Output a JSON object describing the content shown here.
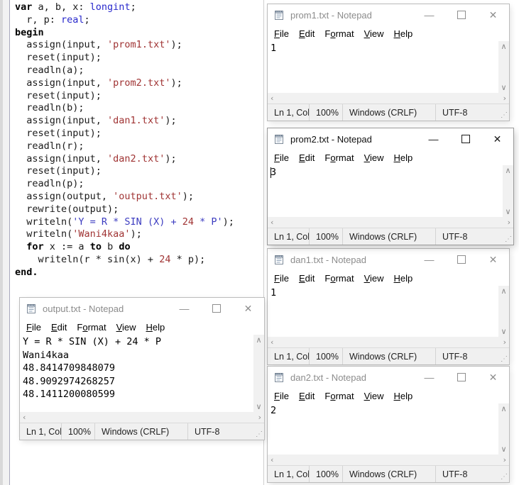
{
  "colors": {
    "keyword": "#000000",
    "type": "#2828cc",
    "string": "#a03434",
    "string_blue": "#3c3cc0",
    "number": "#a03434",
    "status_bg": "#f0f0f0",
    "inactive_title": "#8c8c8c",
    "active_title": "#111111"
  },
  "icons": {
    "minimize": "—",
    "close": "✕",
    "scroll_up": "∧",
    "scroll_down": "∨",
    "scroll_left": "‹",
    "scroll_right": "›",
    "resize_grip": "⋰",
    "app_icon": "notepad-icon"
  },
  "menu": {
    "items": [
      {
        "label": "File",
        "u": 0
      },
      {
        "label": "Edit",
        "u": 0
      },
      {
        "label": "Format",
        "u": 1
      },
      {
        "label": "View",
        "u": 0
      },
      {
        "label": "Help",
        "u": 0
      }
    ]
  },
  "status": {
    "line": "Ln 1, Col",
    "zoom": "100%",
    "eol": "Windows (CRLF)",
    "encoding": "UTF-8"
  },
  "windows": [
    {
      "id": "prom1",
      "title": "prom1.txt - Notepad",
      "active": false,
      "caret": false,
      "lines": [
        "1"
      ]
    },
    {
      "id": "prom2",
      "title": "prom2.txt - Notepad",
      "active": true,
      "caret": true,
      "lines": [
        "3"
      ]
    },
    {
      "id": "dan1",
      "title": "dan1.txt - Notepad",
      "active": false,
      "caret": false,
      "lines": [
        "1"
      ]
    },
    {
      "id": "dan2",
      "title": "dan2.txt - Notepad",
      "active": false,
      "caret": false,
      "lines": [
        "2"
      ]
    },
    {
      "id": "output",
      "title": "output.txt - Notepad",
      "active": false,
      "caret": false,
      "lines": [
        "Y = R * SIN (X) + 24 * P",
        "Wani4kaa",
        "48.8414709848079",
        "48.9092974268257",
        "48.1411200080599"
      ]
    }
  ],
  "editor": {
    "lines": [
      [
        [
          "k",
          "var"
        ],
        [
          "p",
          " a, b, x: "
        ],
        [
          "t",
          "longint"
        ],
        [
          "p",
          ";"
        ]
      ],
      [
        [
          "p",
          "  r, p: "
        ],
        [
          "t",
          "real"
        ],
        [
          "p",
          ";"
        ]
      ],
      [
        [
          "k",
          "begin"
        ]
      ],
      [
        [
          "p",
          "  assign(input, "
        ],
        [
          "s",
          "'prom1.txt'"
        ],
        [
          "p",
          ");"
        ]
      ],
      [
        [
          "p",
          "  reset(input);"
        ]
      ],
      [
        [
          "p",
          "  readln(a);"
        ]
      ],
      [
        [
          "p",
          "  assign(input, "
        ],
        [
          "s",
          "'prom2.txt'"
        ],
        [
          "p",
          ");"
        ]
      ],
      [
        [
          "p",
          "  reset(input);"
        ]
      ],
      [
        [
          "p",
          "  readln(b);"
        ]
      ],
      [
        [
          "p",
          "  assign(input, "
        ],
        [
          "s",
          "'dan1.txt'"
        ],
        [
          "p",
          ");"
        ]
      ],
      [
        [
          "p",
          "  reset(input);"
        ]
      ],
      [
        [
          "p",
          "  readln(r);"
        ]
      ],
      [
        [
          "p",
          "  assign(input, "
        ],
        [
          "s",
          "'dan2.txt'"
        ],
        [
          "p",
          ");"
        ]
      ],
      [
        [
          "p",
          "  reset(input);"
        ]
      ],
      [
        [
          "p",
          "  readln(p);"
        ]
      ],
      [
        [
          "p",
          "  assign(output, "
        ],
        [
          "s",
          "'output.txt'"
        ],
        [
          "p",
          ");"
        ]
      ],
      [
        [
          "p",
          "  rewrite(output);"
        ]
      ],
      [
        [
          "p",
          "  writeln("
        ],
        [
          "b",
          "'Y = R * SIN (X) + "
        ],
        [
          "n",
          "24"
        ],
        [
          "b",
          " * P'"
        ],
        [
          "p",
          ");"
        ]
      ],
      [
        [
          "p",
          "  writeln("
        ],
        [
          "s",
          "'Wani4kaa'"
        ],
        [
          "p",
          ");"
        ]
      ],
      [
        [
          "p",
          "  "
        ],
        [
          "k",
          "for"
        ],
        [
          "p",
          " x := a "
        ],
        [
          "k",
          "to"
        ],
        [
          "p",
          " b "
        ],
        [
          "k",
          "do"
        ]
      ],
      [
        [
          "p",
          "    writeln(r * sin(x) + "
        ],
        [
          "n",
          "24"
        ],
        [
          "p",
          " * p);"
        ]
      ],
      [
        [
          "k",
          "end."
        ]
      ]
    ]
  }
}
